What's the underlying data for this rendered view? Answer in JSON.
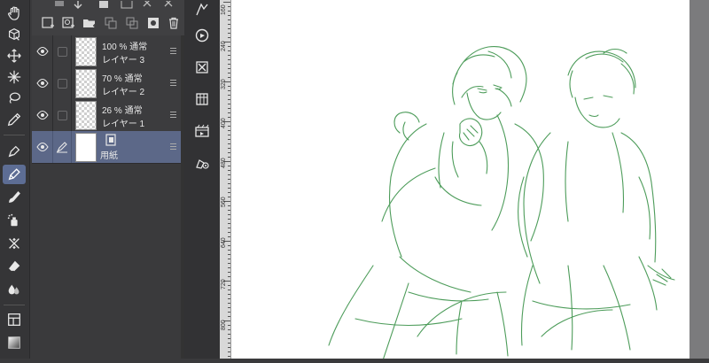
{
  "toolbar": {
    "tools": [
      {
        "name": "hand-tool",
        "icon": "hand-icon"
      },
      {
        "name": "object-tool",
        "icon": "cube-icon"
      },
      {
        "name": "move-tool",
        "icon": "move-icon"
      },
      {
        "name": "auto-select-tool",
        "icon": "sparkle-icon"
      },
      {
        "name": "lasso-tool",
        "icon": "lasso-icon"
      },
      {
        "name": "eyedropper-tool",
        "icon": "eyedropper-icon"
      },
      {
        "name": "pen-tool",
        "icon": "pen-icon"
      },
      {
        "name": "pencil-tool",
        "icon": "pencil-icon",
        "active": true
      },
      {
        "name": "brush-tool",
        "icon": "brush-icon"
      },
      {
        "name": "airbrush-tool",
        "icon": "airbrush-icon"
      },
      {
        "name": "decoration-tool",
        "icon": "decoration-icon"
      },
      {
        "name": "eraser-tool",
        "icon": "eraser-icon"
      },
      {
        "name": "blend-tool",
        "icon": "drops-icon"
      },
      {
        "name": "frame-tool",
        "icon": "frame-icon"
      },
      {
        "name": "gradient-tool",
        "icon": "gradient-icon"
      }
    ]
  },
  "layers": [
    {
      "opacity": "100 %",
      "blend": "通常",
      "name": "レイヤー 3",
      "type": "transparent"
    },
    {
      "opacity": "70 %",
      "blend": "通常",
      "name": "レイヤー 2",
      "type": "transparent"
    },
    {
      "opacity": "26 %",
      "blend": "通常",
      "name": "レイヤー 1",
      "type": "transparent"
    },
    {
      "name": "用紙",
      "type": "paper",
      "selected": true
    }
  ],
  "ruler": {
    "labels": [
      "160",
      "240",
      "320",
      "400",
      "480",
      "560",
      "640",
      "720",
      "800"
    ]
  },
  "colors": {
    "accent": "#5c6888",
    "sketch": "#2e8b3e",
    "panel": "#3a3a3c"
  }
}
